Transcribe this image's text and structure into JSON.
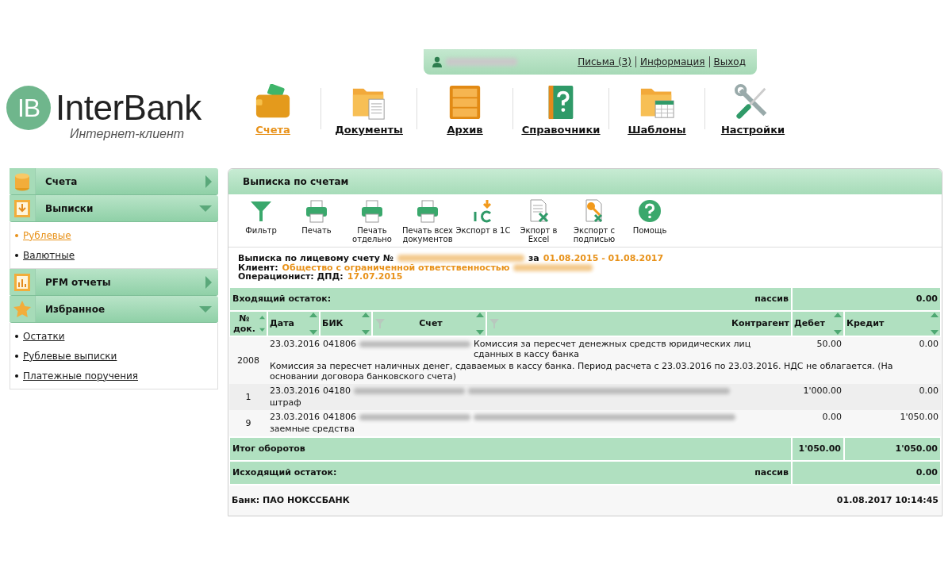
{
  "user_bar": {
    "links": [
      "Письма (3)",
      "Информация",
      "Выход"
    ]
  },
  "logo": {
    "mark": "IB",
    "name": "InterBank",
    "subtitle": "Интернет-клиент"
  },
  "nav": [
    {
      "label": "Счета",
      "selected": true
    },
    {
      "label": "Документы",
      "selected": false
    },
    {
      "label": "Архив",
      "selected": false
    },
    {
      "label": "Справочники",
      "selected": false
    },
    {
      "label": "Шаблоны",
      "selected": false
    },
    {
      "label": "Настройки",
      "selected": false
    }
  ],
  "sidebar": [
    {
      "label": "Счета",
      "expanded": false
    },
    {
      "label": "Выписки",
      "expanded": true,
      "items": [
        {
          "label": "Рублевые",
          "selected": true
        },
        {
          "label": "Валютные",
          "selected": false
        }
      ]
    },
    {
      "label": "PFM отчеты",
      "expanded": false
    },
    {
      "label": "Избранное",
      "expanded": true,
      "items": [
        {
          "label": "Остатки",
          "selected": false
        },
        {
          "label": "Рублевые выписки",
          "selected": false
        },
        {
          "label": "Платежные поручения",
          "selected": false
        }
      ]
    }
  ],
  "panel": {
    "title": "Выписка по счетам",
    "toolbar": [
      "Фильтр",
      "Печать",
      "Печать отдельно",
      "Печать всех документов",
      "Экспорт в 1С",
      "Экпорт в Excel",
      "Экспорт с подписью",
      "Помощь"
    ],
    "info": {
      "account_label": "Выписка по лицевому счету №",
      "period_label": "за",
      "period": "01.08.2015 - 01.08.2017",
      "client_label": "Клиент:",
      "client": "Общество с ограниченной ответственностью",
      "operator_label": "Операционист: ДПД:",
      "operator_date": "17.07.2015"
    },
    "opening": {
      "label": "Входящий остаток:",
      "type": "пассив",
      "amount": "0.00"
    },
    "columns": [
      {
        "label": "№ док.",
        "sortable": true,
        "filterable": false
      },
      {
        "label": "Дата",
        "sortable": true,
        "filterable": false
      },
      {
        "label": "БИК",
        "sortable": true,
        "filterable": false
      },
      {
        "label": "Счет",
        "sortable": true,
        "filterable": true
      },
      {
        "label": "Контрагент",
        "sortable": false,
        "filterable": true
      },
      {
        "label": "Дебет",
        "sortable": true,
        "filterable": false
      },
      {
        "label": "Кредит",
        "sortable": true,
        "filterable": false
      }
    ],
    "rows": [
      {
        "number": "2008",
        "date": "23.03.2016",
        "bik": "041806",
        "counterparty": "Комиссия за пересчет денежных средств юридических лиц сданных в кассу банка",
        "purpose": "Комиссия за пересчет наличных денег, сдаваемых в кассу банка. Период расчета с 23.03.2016 по 23.03.2016. НДС не облагается. (На основании договора банковского счета)",
        "debit": "50.00",
        "credit": "0.00"
      },
      {
        "number": "1",
        "date": "23.03.2016",
        "bik": "04180",
        "purpose": "штраф",
        "debit": "1'000.00",
        "credit": "0.00"
      },
      {
        "number": "9",
        "date": "23.03.2016",
        "bik": "041806",
        "purpose": "заемные средства",
        "debit": "0.00",
        "credit": "1'050.00"
      }
    ],
    "turnover": {
      "label": "Итог оборотов",
      "debit": "1'050.00",
      "credit": "1'050.00"
    },
    "closing": {
      "label": "Исходящий остаток:",
      "type": "пассив",
      "amount": "0.00"
    },
    "footer": {
      "bank": "Банк: ПАО НОКССБАНК",
      "timestamp": "01.08.2017 10:14:45"
    }
  }
}
